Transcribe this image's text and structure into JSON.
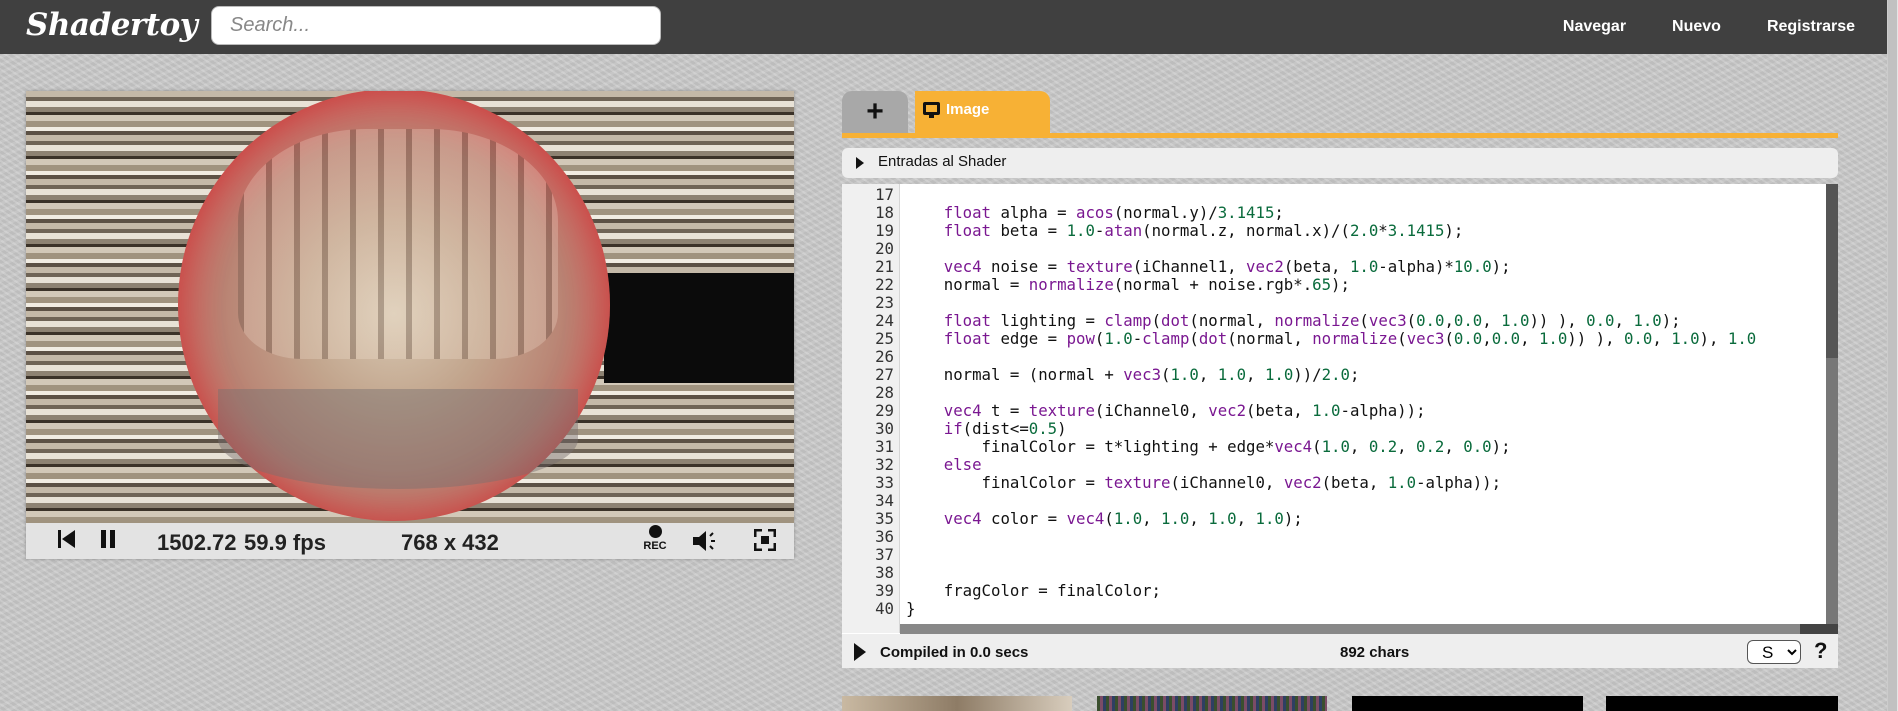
{
  "header": {
    "logo": "Shadertoy",
    "search_placeholder": "Search...",
    "nav": [
      "Navegar",
      "Nuevo",
      "Registrarse"
    ]
  },
  "viewer": {
    "time": "1502.72",
    "fps": "59.9 fps",
    "resolution": "768 x 432",
    "rec_label": "REC"
  },
  "editor": {
    "add_tab": "+",
    "image_tab": "Image",
    "inputs_label": "Entradas al Shader",
    "lines": [
      {
        "n": "17",
        "html": ""
      },
      {
        "n": "18",
        "html": "    <span class='kw'>float</span> alpha = <span class='cls'>acos</span>(normal.y)/<span class='num'>3.1415</span>;"
      },
      {
        "n": "19",
        "html": "    <span class='kw'>float</span> beta = <span class='num'>1.0</span>-<span class='cls'>atan</span>(normal.z, normal.x)/(<span class='num'>2.0</span>*<span class='num'>3.1415</span>);"
      },
      {
        "n": "20",
        "html": ""
      },
      {
        "n": "21",
        "html": "    <span class='kw'>vec4</span> noise = <span class='cls'>texture</span>(iChannel1, <span class='kw'>vec2</span>(beta, <span class='num'>1.0</span>-alpha)*<span class='num'>10.0</span>);"
      },
      {
        "n": "22",
        "html": "    normal = <span class='cls'>normalize</span>(normal + noise.rgb*.<span class='num'>65</span>);"
      },
      {
        "n": "23",
        "html": ""
      },
      {
        "n": "24",
        "html": "    <span class='kw'>float</span> lighting = <span class='cls'>clamp</span>(<span class='cls'>dot</span>(normal, <span class='cls'>normalize</span>(<span class='kw'>vec3</span>(<span class='num'>0.0</span>,<span class='num'>0.0</span>, <span class='num'>1.0</span>)) ), <span class='num'>0.0</span>, <span class='num'>1.0</span>);"
      },
      {
        "n": "25",
        "html": "    <span class='kw'>float</span> edge = <span class='cls'>pow</span>(<span class='num'>1.0</span>-<span class='cls'>clamp</span>(<span class='cls'>dot</span>(normal, <span class='cls'>normalize</span>(<span class='kw'>vec3</span>(<span class='num'>0.0</span>,<span class='num'>0.0</span>, <span class='num'>1.0</span>)) ), <span class='num'>0.0</span>, <span class='num'>1.0</span>), <span class='num'>1.0</span>"
      },
      {
        "n": "26",
        "html": ""
      },
      {
        "n": "27",
        "html": "    normal = (normal + <span class='kw'>vec3</span>(<span class='num'>1.0</span>, <span class='num'>1.0</span>, <span class='num'>1.0</span>))/<span class='num'>2.0</span>;"
      },
      {
        "n": "28",
        "html": ""
      },
      {
        "n": "29",
        "html": "    <span class='kw'>vec4</span> t = <span class='cls'>texture</span>(iChannel0, <span class='kw'>vec2</span>(beta, <span class='num'>1.0</span>-alpha));"
      },
      {
        "n": "30",
        "html": "    <span class='kw'>if</span>(dist&lt;=<span class='num'>0.5</span>)"
      },
      {
        "n": "31",
        "html": "        finalColor = t*lighting + edge*<span class='kw'>vec4</span>(<span class='num'>1.0</span>, <span class='num'>0.2</span>, <span class='num'>0.2</span>, <span class='num'>0.0</span>);"
      },
      {
        "n": "32",
        "html": "    <span class='kw'>else</span>"
      },
      {
        "n": "33",
        "html": "        finalColor = <span class='cls'>texture</span>(iChannel0, <span class='kw'>vec2</span>(beta, <span class='num'>1.0</span>-alpha));"
      },
      {
        "n": "34",
        "html": ""
      },
      {
        "n": "35",
        "html": "    <span class='kw'>vec4</span> color = <span class='kw'>vec4</span>(<span class='num'>1.0</span>, <span class='num'>1.0</span>, <span class='num'>1.0</span>, <span class='num'>1.0</span>);"
      },
      {
        "n": "36",
        "html": ""
      },
      {
        "n": "37",
        "html": ""
      },
      {
        "n": "38",
        "html": ""
      },
      {
        "n": "39",
        "html": "    fragColor = finalColor;"
      },
      {
        "n": "40",
        "html": "}"
      }
    ]
  },
  "status": {
    "compiled": "Compiled in 0.0 secs",
    "chars": "892 chars",
    "font_option": "S",
    "help": "?"
  },
  "icons": {
    "rewind": "skip-back-icon",
    "pause": "pause-icon",
    "record": "record-icon",
    "volume": "volume-icon",
    "fullscreen": "fullscreen-icon"
  },
  "colors": {
    "accent": "#f7b135",
    "topbar": "#404040",
    "keyword": "#7a1791",
    "number": "#0a6b3c"
  }
}
